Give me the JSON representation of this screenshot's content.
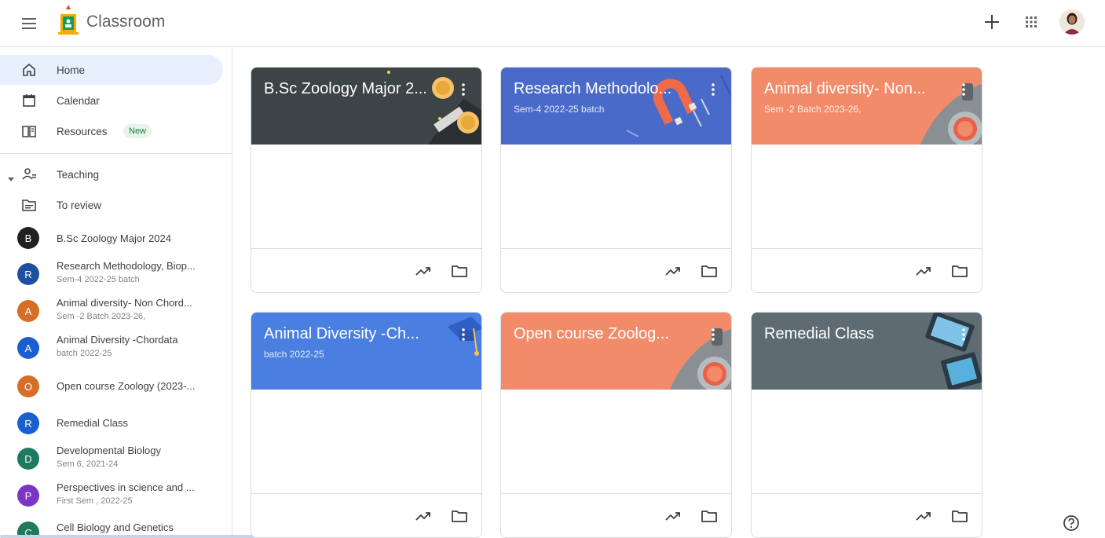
{
  "app": {
    "name": "Classroom"
  },
  "nav": [
    {
      "label": "Home",
      "icon": "home-icon",
      "active": true
    },
    {
      "label": "Calendar",
      "icon": "calendar-icon"
    },
    {
      "label": "Resources",
      "icon": "resources-icon",
      "badge": "New"
    }
  ],
  "teaching": {
    "label": "Teaching",
    "review_label": "To review"
  },
  "sidebar_classes": [
    {
      "letter": "B",
      "name": "B.Sc Zoology Major 2024",
      "sub": "",
      "color": "#202124"
    },
    {
      "letter": "R",
      "name": "Research Methodology, Biop...",
      "sub": "Sem-4 2022-25 batch",
      "color": "#1e4fa0"
    },
    {
      "letter": "A",
      "name": "Animal diversity- Non Chord...",
      "sub": "Sem -2 Batch 2023-26,",
      "color": "#d56e27"
    },
    {
      "letter": "A",
      "name": "Animal Diversity -Chordata",
      "sub": "batch 2022-25",
      "color": "#1a5fd0"
    },
    {
      "letter": "O",
      "name": "Open course Zoology (2023-...",
      "sub": "",
      "color": "#d56e27"
    },
    {
      "letter": "R",
      "name": "Remedial Class",
      "sub": "",
      "color": "#1a5fd0"
    },
    {
      "letter": "D",
      "name": "Developmental Biology",
      "sub": "Sem 6, 2021-24",
      "color": "#1e7a5e"
    },
    {
      "letter": "P",
      "name": "Perspectives in science and ...",
      "sub": "First Sem , 2022-25",
      "color": "#7b35c4"
    },
    {
      "letter": "C",
      "name": "Cell Biology and Genetics",
      "sub": "",
      "color": "#1e7a5e"
    }
  ],
  "cards": [
    {
      "title": "B.Sc Zoology Major 2...",
      "sub": "",
      "color": "#3c4446",
      "art": "coins"
    },
    {
      "title": "Research Methodolo...",
      "sub": "Sem-4 2022-25 batch",
      "color": "#4a6ac9",
      "art": "magnet"
    },
    {
      "title": "Animal diversity- Non...",
      "sub": "Sem -2 Batch 2023-26,",
      "color": "#f28b6a",
      "art": "lab"
    },
    {
      "title": "Animal Diversity -Ch...",
      "sub": "batch 2022-25",
      "color": "#4a7ee0",
      "art": "grad"
    },
    {
      "title": "Open course Zoolog...",
      "sub": "",
      "color": "#f28b6a",
      "art": "lab"
    },
    {
      "title": "Remedial Class",
      "sub": "",
      "color": "#5f6b72",
      "art": "devices"
    }
  ],
  "colors": {
    "accent": "#1a73e8",
    "active_bg": "#e8f0fe"
  }
}
